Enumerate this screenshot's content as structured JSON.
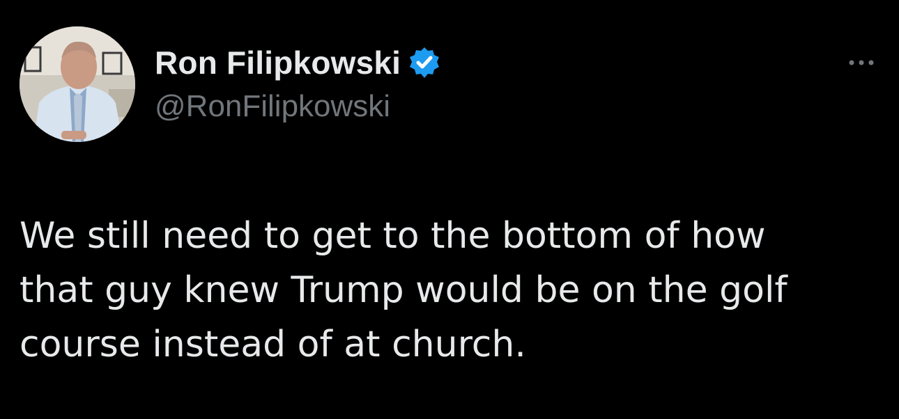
{
  "author": {
    "display_name": "Ron Filipkowski",
    "handle": "@RonFilipkowski",
    "verified": true,
    "verified_badge_color": "#1d9bf0"
  },
  "tweet": {
    "text": "We still need to get to the bottom of how\nthat guy knew Trump would be on the golf\ncourse instead of at church."
  },
  "icons": {
    "avatar": "avatar-photo",
    "verified": "verified-badge-icon",
    "more": "more-options-icon"
  },
  "colors": {
    "background": "#000000",
    "primary_text": "#e7e9ea",
    "secondary_text": "#71767b"
  }
}
